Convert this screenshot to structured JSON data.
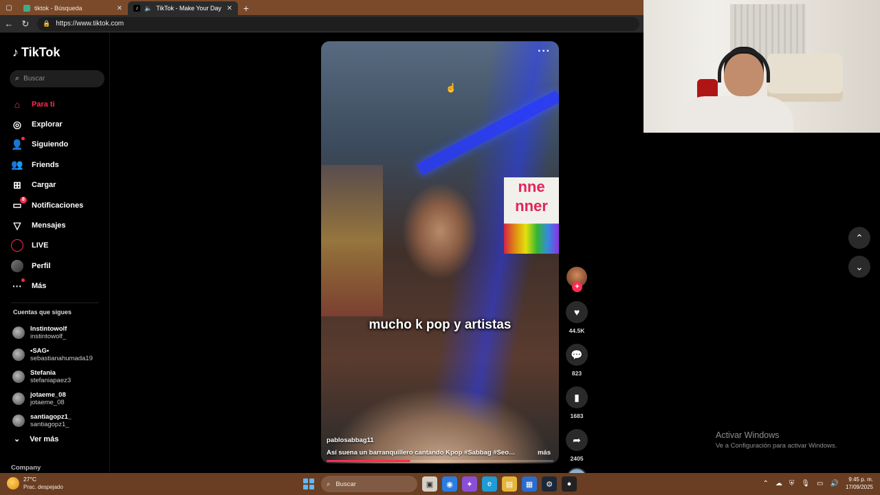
{
  "browser": {
    "tabs": [
      {
        "label": "tiktok - Búsqueda",
        "active": false
      },
      {
        "label": "TikTok - Make Your Day",
        "active": true
      }
    ],
    "url": "https://www.tiktok.com"
  },
  "sidebar": {
    "logo": "TikTok",
    "search_placeholder": "Buscar",
    "nav": [
      {
        "label": "Para ti",
        "icon": "home-icon",
        "active": true
      },
      {
        "label": "Explorar",
        "icon": "compass-icon"
      },
      {
        "label": "Siguiendo",
        "icon": "following-icon"
      },
      {
        "label": "Friends",
        "icon": "friends-icon"
      },
      {
        "label": "Cargar",
        "icon": "upload-icon"
      },
      {
        "label": "Notificaciones",
        "icon": "notifications-icon",
        "badge": "8"
      },
      {
        "label": "Mensajes",
        "icon": "messages-icon"
      },
      {
        "label": "LIVE",
        "icon": "live-icon"
      },
      {
        "label": "Perfil",
        "icon": "profile-avatar"
      },
      {
        "label": "Más",
        "icon": "more-icon"
      }
    ],
    "following_title": "Cuentas que sigues",
    "following": [
      {
        "name": "Instintowolf",
        "user": "instintowolf_"
      },
      {
        "name": "•SAG•",
        "user": "sebastianahumada19"
      },
      {
        "name": "Stefania",
        "user": "stefaniapaez3"
      },
      {
        "name": "jotaeme_08",
        "user": "jotaeme_08"
      },
      {
        "name": "santiagopz1_",
        "user": "santiagopz1_"
      }
    ],
    "see_more": "Ver más",
    "company": "Company"
  },
  "video": {
    "caption_overlay": "mucho k pop y artistas",
    "author": "pablosabbag11",
    "description": "Así suena un barranquillero cantando Kpop #Sabbag #Seoul ...",
    "more_label": "más",
    "progress": 0.37,
    "sign_text": "nne\nnner"
  },
  "actions": {
    "likes": "44.5K",
    "comments": "823",
    "saves": "1683",
    "shares": "2405"
  },
  "activation": {
    "title": "Activar Windows",
    "subtitle": "Ve a Configuración para activar Windows."
  },
  "taskbar": {
    "temperature": "27°C",
    "weather": "Prac. despejado",
    "search": "Buscar",
    "time": "9:45 p. m.",
    "date": "17/09/2025"
  },
  "colors": {
    "accent": "#fe2c55",
    "background": "#000000",
    "taskbar": "#6a3e22"
  }
}
